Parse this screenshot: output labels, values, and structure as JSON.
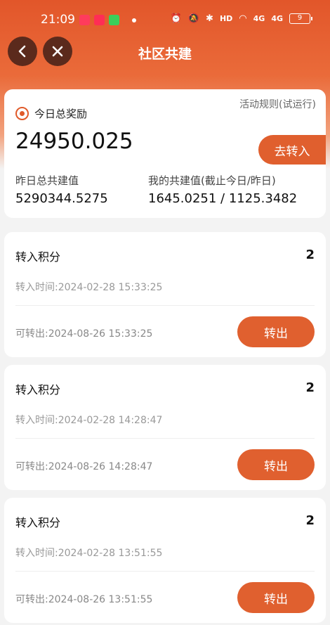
{
  "status_bar": {
    "time": "21:09",
    "network_label": "HD",
    "signal_1": "4G",
    "signal_2": "4G",
    "battery": "9"
  },
  "nav": {
    "title": "社区共建",
    "back_icon": "chevron-left-icon",
    "close_icon": "close-icon"
  },
  "summary": {
    "reward_label": "今日总奖励",
    "rules_link": "活动规则(试运行)",
    "reward_value": "24950.025",
    "transfer_in_label": "去转入",
    "yesterday_label": "昨日总共建值",
    "yesterday_value": "5290344.5275",
    "mine_label": "我的共建值(截止今日/昨日)",
    "mine_value": "1645.0251 / 1125.3482"
  },
  "records": [
    {
      "title": "转入积分",
      "amount": "2",
      "time": "转入时间:2024-02-28 15:33:25",
      "release": "可转出:2024-08-26 15:33:25",
      "button": "转出"
    },
    {
      "title": "转入积分",
      "amount": "2",
      "time": "转入时间:2024-02-28 14:28:47",
      "release": "可转出:2024-08-26 14:28:47",
      "button": "转出"
    },
    {
      "title": "转入积分",
      "amount": "2",
      "time": "转入时间:2024-02-28 13:51:55",
      "release": "可转出:2024-08-26 13:51:55",
      "button": "转出"
    }
  ],
  "colors": {
    "accent": "#e05f2e",
    "header_top": "#e2562a",
    "nav_button": "#5b2a1c"
  }
}
